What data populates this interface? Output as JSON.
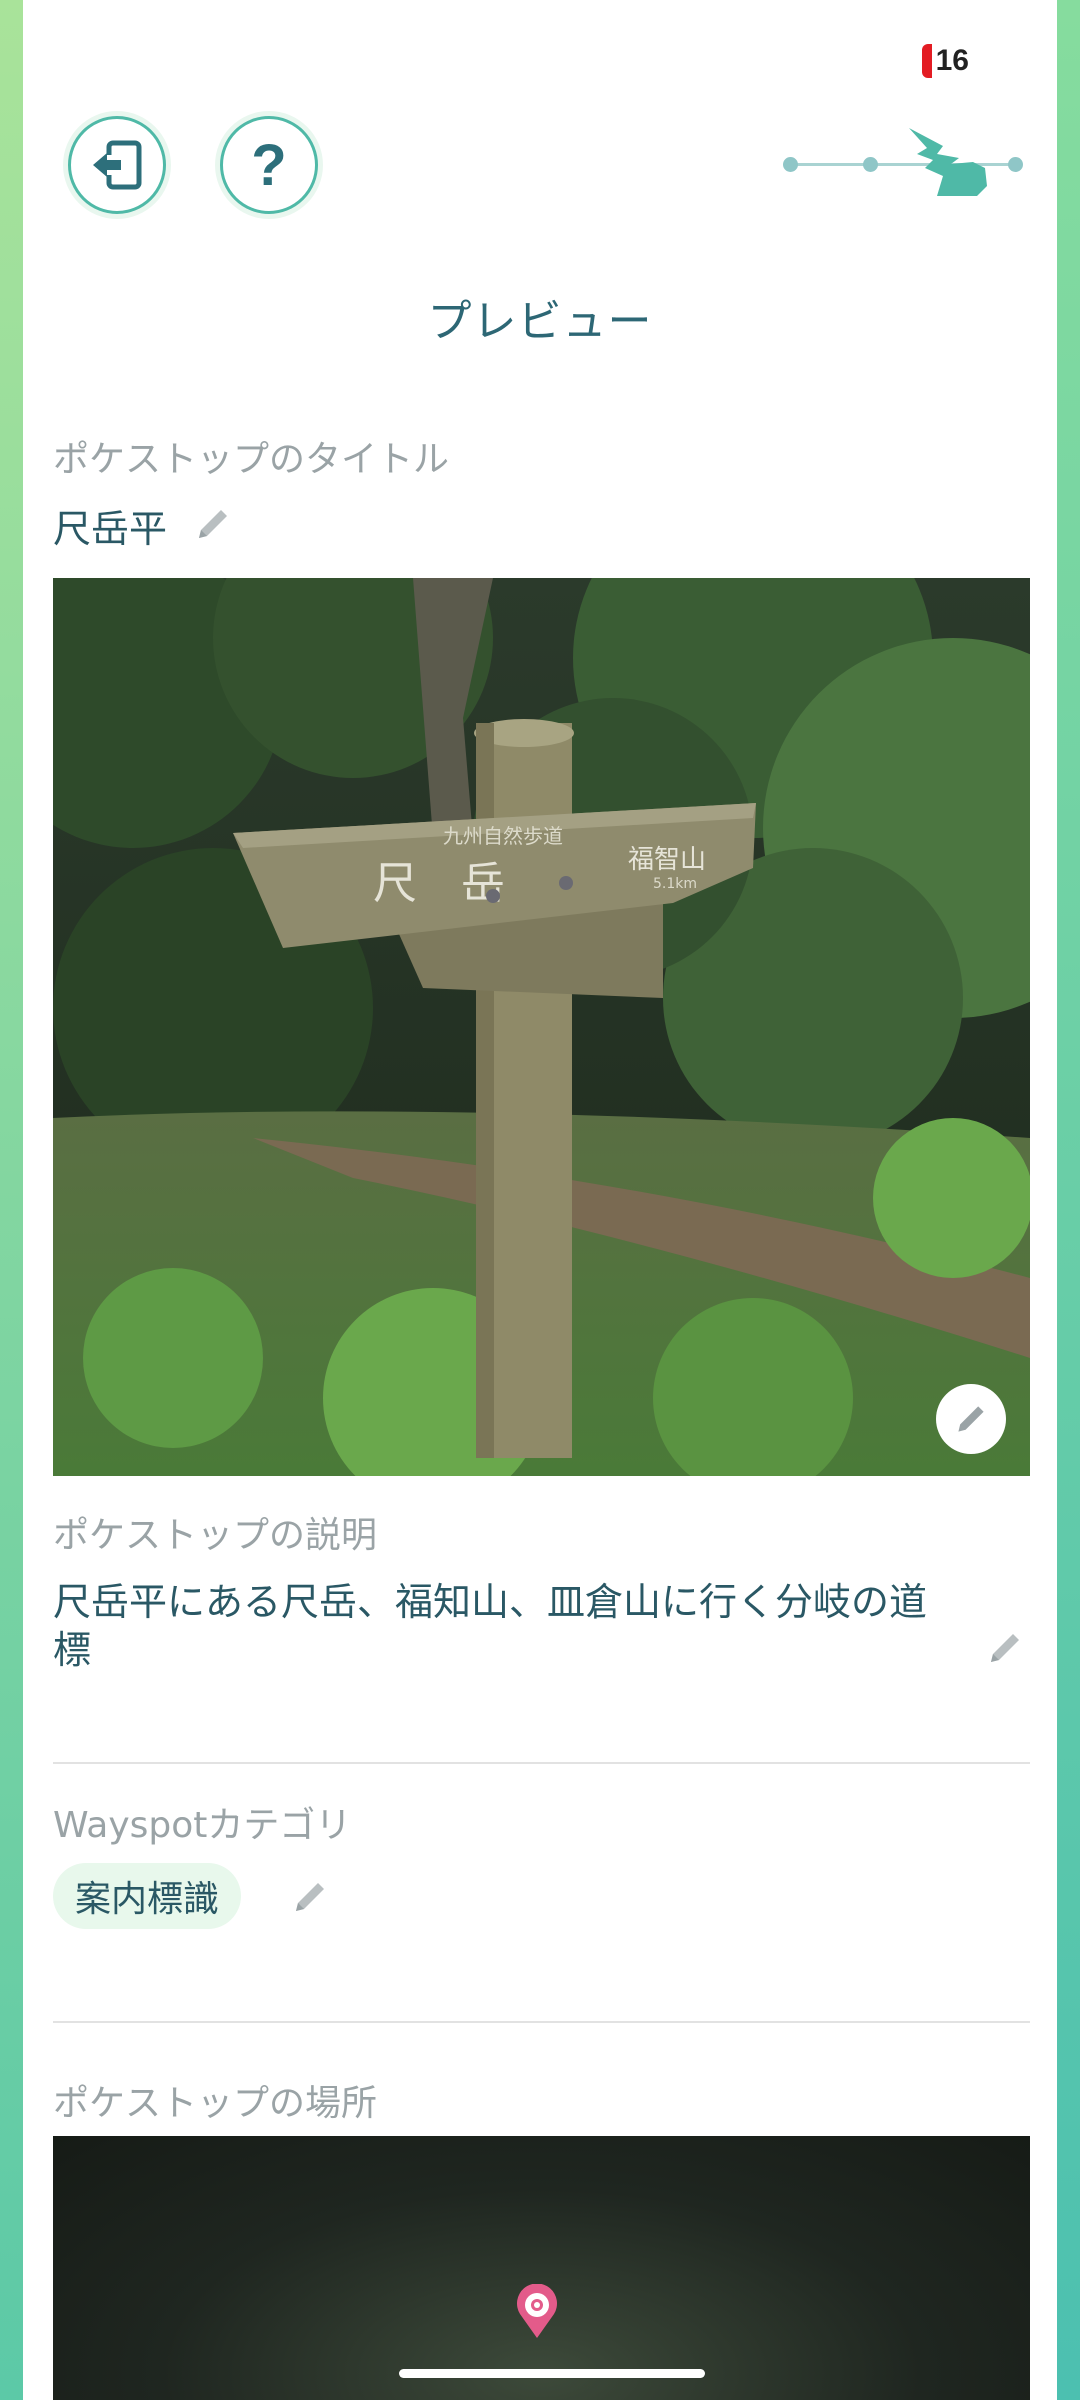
{
  "status": {
    "battery_level": "16"
  },
  "header": {
    "exit_icon": "exit-door-icon",
    "help_icon": "question-icon",
    "help_label": "?",
    "progress_mascot_icon": "pikachu-tail-icon"
  },
  "page_title": "プレビュー",
  "title_section": {
    "label": "ポケストップのタイトル",
    "value": "尺岳平"
  },
  "photo": {
    "sign_main_text": "尺　岳",
    "sign_top_text": "九州自然歩道",
    "sign_right_text": "福智山",
    "sign_distance": "5.1km",
    "edit_icon": "pencil-icon"
  },
  "description_section": {
    "label": "ポケストップの説明",
    "value": "尺岳平にある尺岳、福知山、皿倉山に行く分岐の道標"
  },
  "category_section": {
    "label": "Wayspotカテゴリ",
    "value": "案内標識"
  },
  "location_section": {
    "label": "ポケストップの場所",
    "pin_icon": "location-pin-icon"
  },
  "colors": {
    "accent": "#4fb9a7",
    "title": "#2d6775",
    "label": "#9aa3a6",
    "chip_bg": "#e8f8ec",
    "pin": "#e35b8a"
  }
}
